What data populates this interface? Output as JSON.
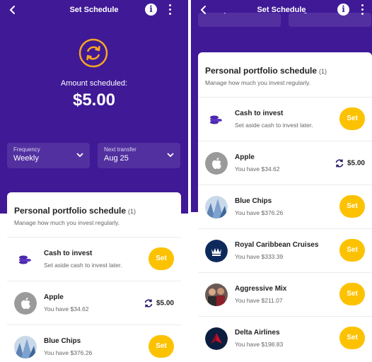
{
  "header": {
    "title": "Set Schedule",
    "info_glyph": "i"
  },
  "hero": {
    "label": "Amount scheduled:",
    "amount": "$5.00"
  },
  "controls": {
    "frequency": {
      "label": "Frequency",
      "value": "Weekly"
    },
    "next_transfer": {
      "label": "Next transfer",
      "value": "Aug 25"
    }
  },
  "card": {
    "title": "Personal portfolio schedule",
    "count": "(1)",
    "subtitle": "Manage how much you invest regularly."
  },
  "items": [
    {
      "name": "Cash to invest",
      "sub": "Set aside cash to invest later.",
      "action": "Set",
      "icon": "coins-icon"
    },
    {
      "name": "Apple",
      "sub": "You have $34.62",
      "action": "$5.00",
      "icon": "apple-logo-icon",
      "scheduled": true
    },
    {
      "name": "Blue Chips",
      "sub": "You have $376.26",
      "action": "Set",
      "icon": "blue-chips-icon"
    },
    {
      "name": "Royal Caribbean Cruises",
      "sub": "You have $333.39",
      "action": "Set",
      "icon": "royal-caribbean-icon"
    },
    {
      "name": "Aggressive Mix",
      "sub": "You have $211.07",
      "action": "Set",
      "icon": "aggressive-mix-icon"
    },
    {
      "name": "Delta Airlines",
      "sub": "You have $198.83",
      "action": "Set",
      "icon": "delta-icon"
    }
  ],
  "colors": {
    "purple": "#3f1996",
    "accent": "#fcc200",
    "hero_icon": "#f5a623"
  }
}
